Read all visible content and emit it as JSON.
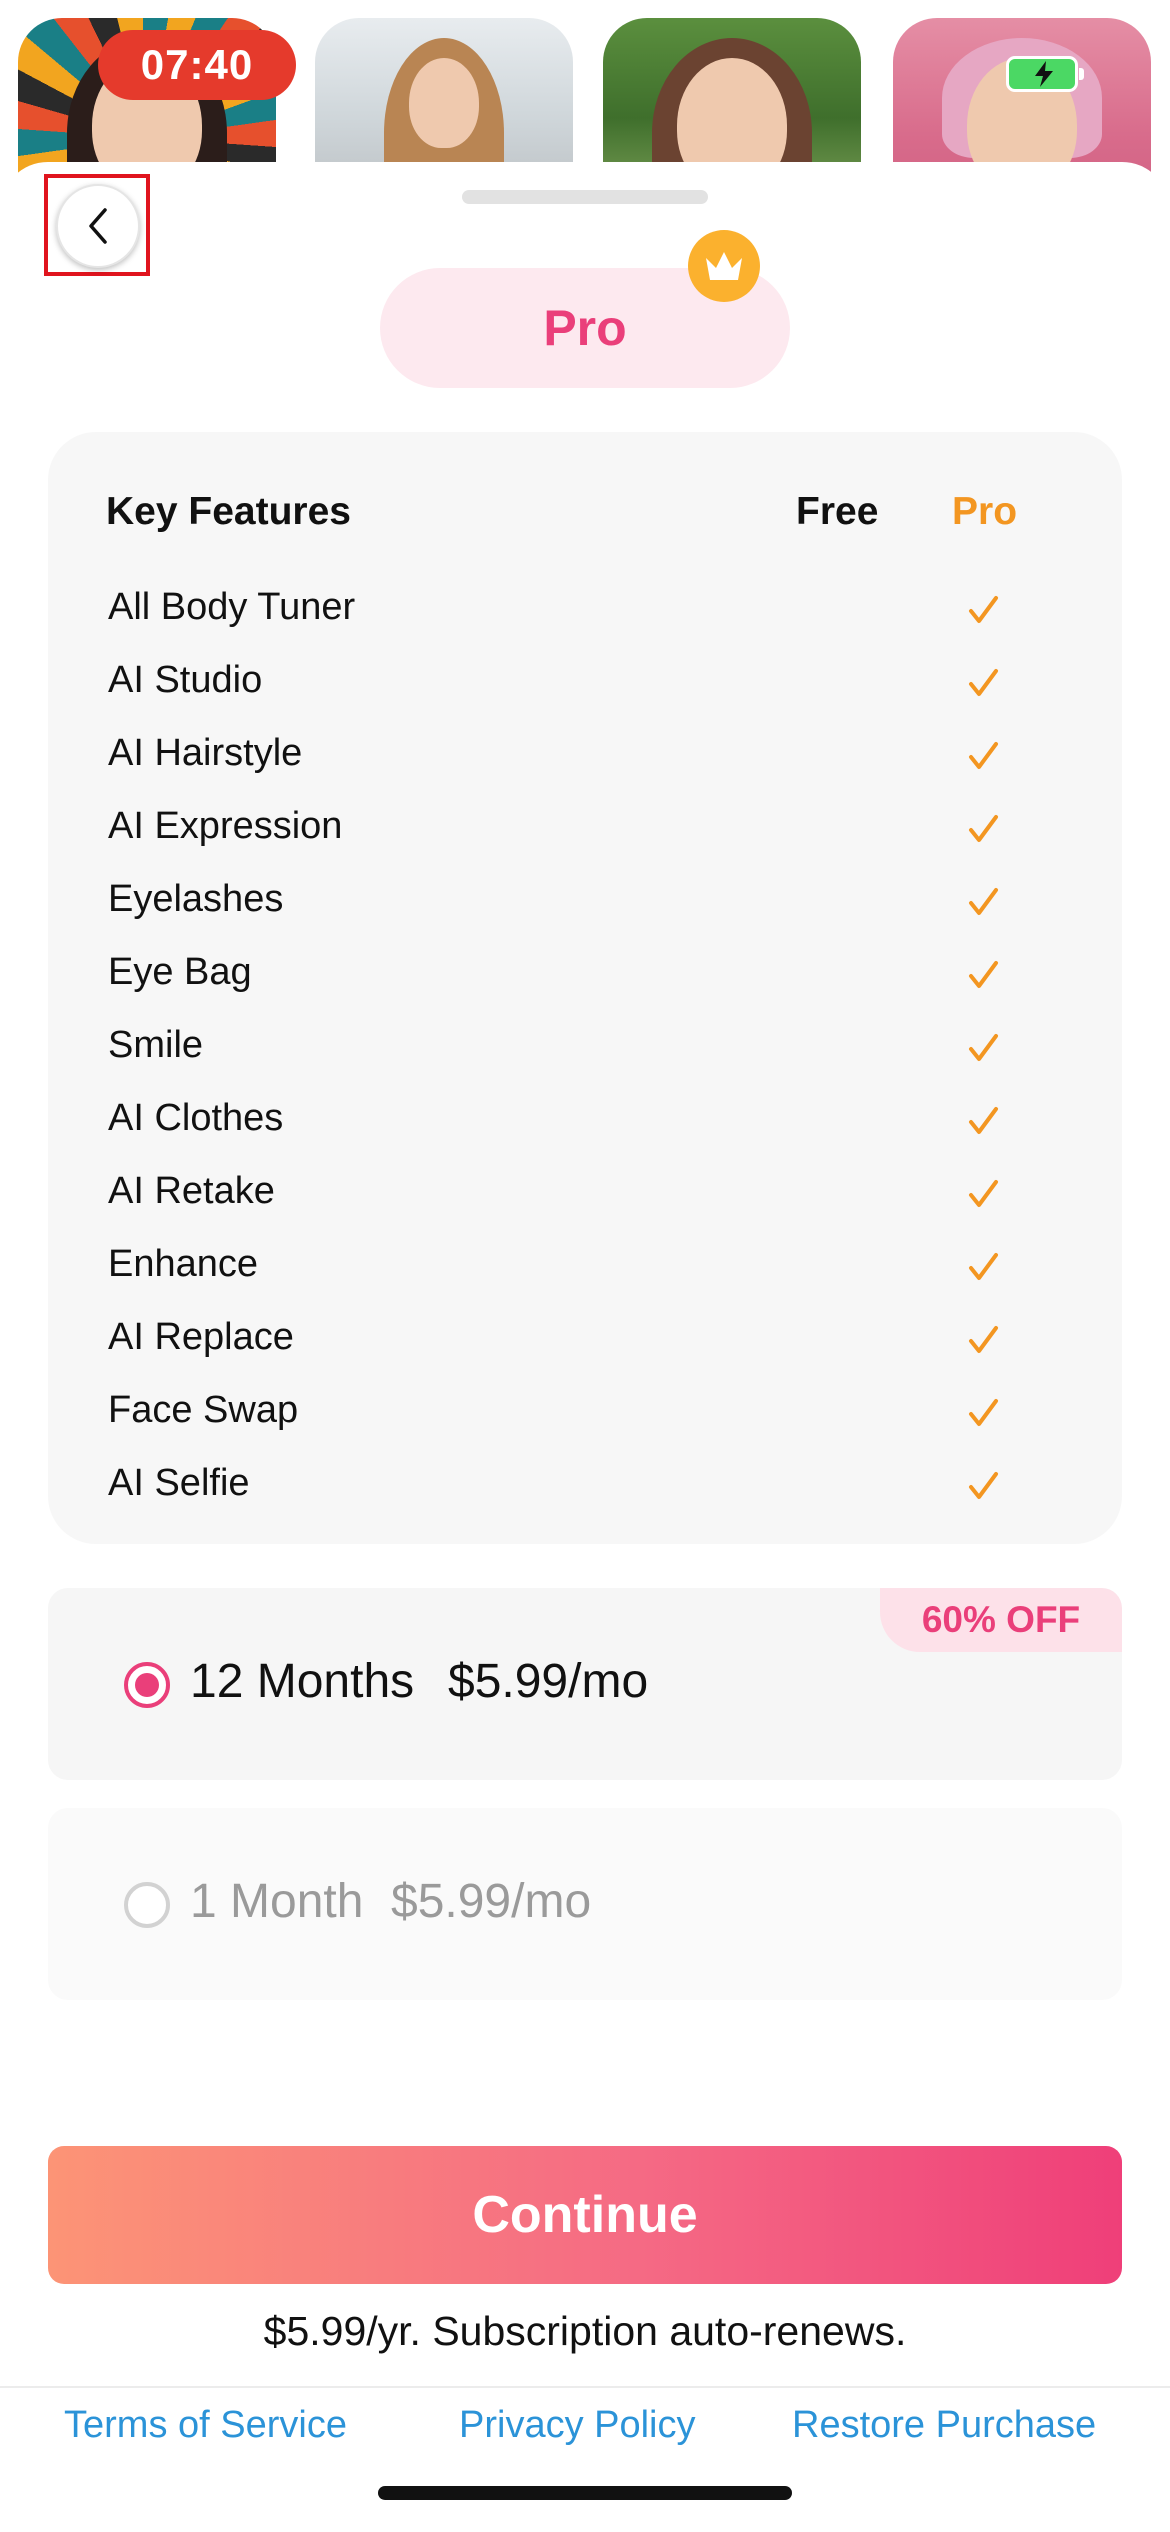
{
  "status_bar": {
    "time": "07:40"
  },
  "icons": {
    "back": "chevron-left-icon",
    "crown": "crown-icon",
    "check": "checkmark-icon",
    "battery": "battery-charging-icon"
  },
  "colors": {
    "accent_pink": "#ea3f7a",
    "pro_orange": "#f39621",
    "link_blue": "#2b93d8",
    "time_pill_red": "#e53a2c"
  },
  "header": {
    "badge_label": "Pro"
  },
  "features": {
    "columns": {
      "key": "Key Features",
      "free": "Free",
      "pro": "Pro"
    },
    "items": [
      {
        "name": "All Body Tuner",
        "free": false,
        "pro": true
      },
      {
        "name": "AI Studio",
        "free": false,
        "pro": true
      },
      {
        "name": "AI Hairstyle",
        "free": false,
        "pro": true
      },
      {
        "name": "AI Expression",
        "free": false,
        "pro": true
      },
      {
        "name": "Eyelashes",
        "free": false,
        "pro": true
      },
      {
        "name": "Eye Bag",
        "free": false,
        "pro": true
      },
      {
        "name": "Smile",
        "free": false,
        "pro": true
      },
      {
        "name": "AI Clothes",
        "free": false,
        "pro": true
      },
      {
        "name": "AI Retake",
        "free": false,
        "pro": true
      },
      {
        "name": "Enhance",
        "free": false,
        "pro": true
      },
      {
        "name": "AI Replace",
        "free": false,
        "pro": true
      },
      {
        "name": "Face Swap",
        "free": false,
        "pro": true
      },
      {
        "name": "AI Selfie",
        "free": false,
        "pro": true
      }
    ]
  },
  "plans": [
    {
      "term": "12 Months",
      "price": "$5.99/mo",
      "badge": "60% OFF",
      "selected": true
    },
    {
      "term": "1 Month",
      "price": "$5.99/mo",
      "selected": false
    }
  ],
  "cta": {
    "continue_label": "Continue",
    "renew_note": "$5.99/yr. Subscription auto-renews."
  },
  "footer": {
    "terms": "Terms of Service",
    "privacy": "Privacy Policy",
    "restore": "Restore Purchase"
  }
}
